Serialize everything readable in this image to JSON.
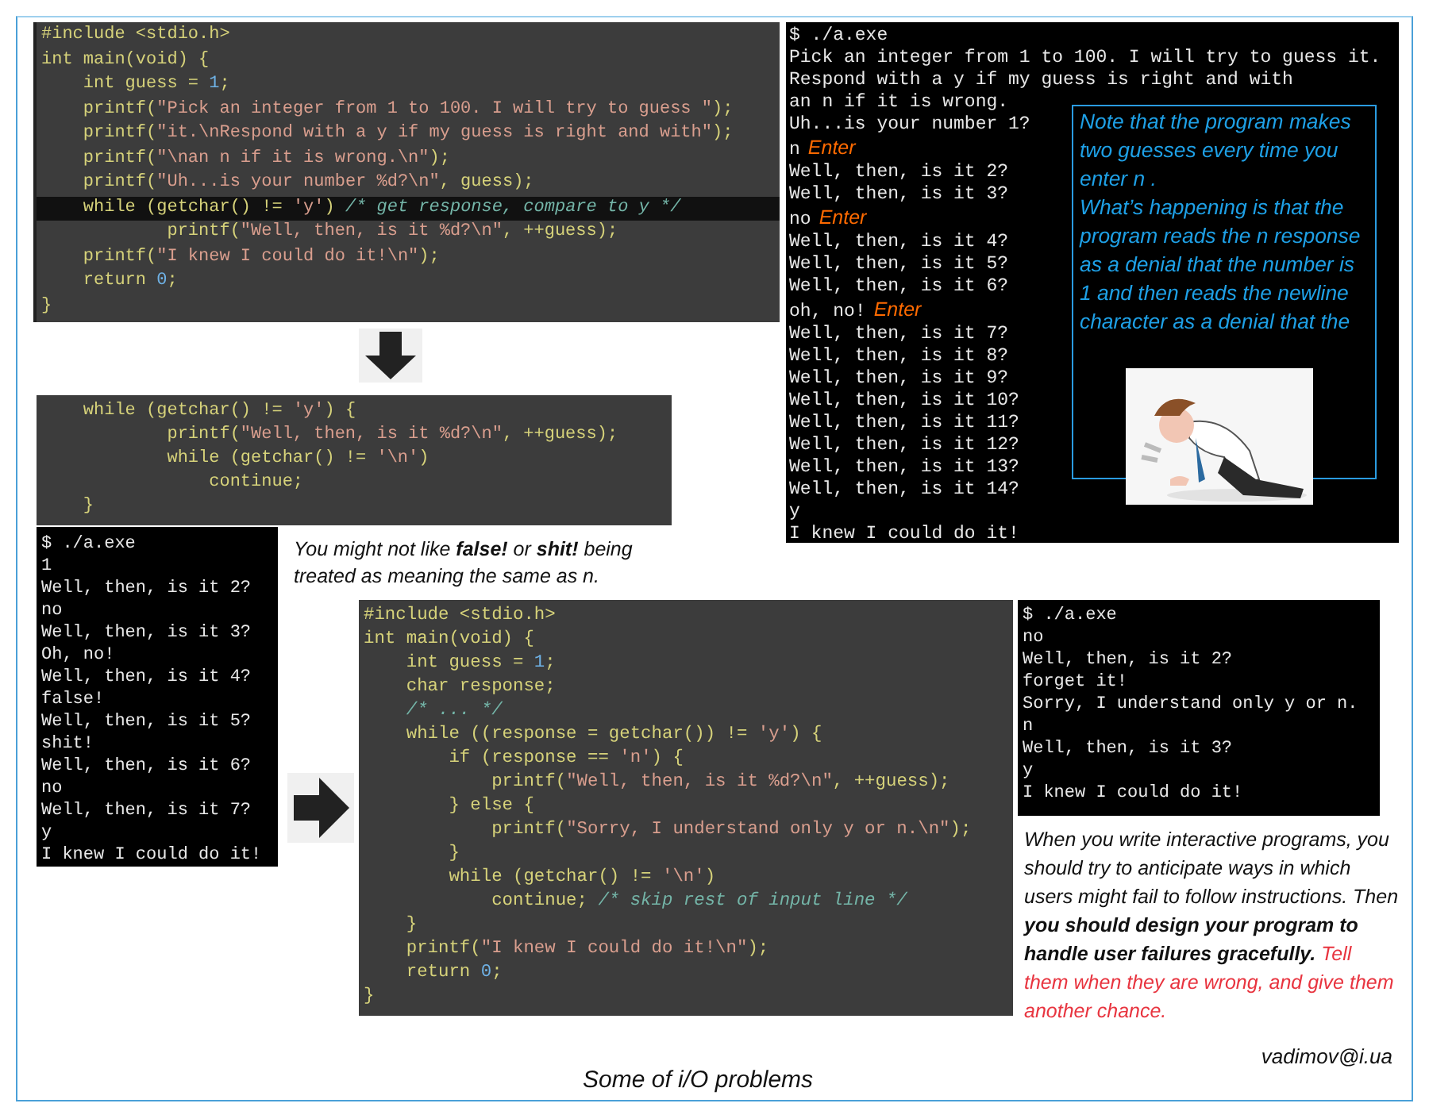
{
  "code_editors": [
    {
      "lines": [
        {
          "text": "#include <stdio.h>",
          "current": false
        },
        {
          "text": "int main(void) {",
          "current": false
        },
        {
          "text": "    int guess = 1;",
          "current": false
        },
        {
          "text": "    printf(\"Pick an integer from 1 to 100. I will try to guess \");",
          "current": false
        },
        {
          "text": "    printf(\"it.\\nRespond with a y if my guess is right and with\");",
          "current": false
        },
        {
          "text": "    printf(\"\\nan n if it is wrong.\\n\");",
          "current": false
        },
        {
          "text": "    printf(\"Uh...is your number %d?\\n\", guess);",
          "current": false
        },
        {
          "text": "    while (getchar() != 'y') /* get response, compare to y */",
          "current": true
        },
        {
          "text": "            printf(\"Well, then, is it %d?\\n\", ++guess);",
          "current": false
        },
        {
          "text": "    printf(\"I knew I could do it!\\n\");",
          "current": false
        },
        {
          "text": "    return 0;",
          "current": false
        },
        {
          "text": "}",
          "current": false
        }
      ]
    },
    {
      "lines": [
        {
          "text": "    while (getchar() != 'y') {",
          "current": false
        },
        {
          "text": "            printf(\"Well, then, is it %d?\\n\", ++guess);",
          "current": false
        },
        {
          "text": "            while (getchar() != '\\n')",
          "current": false
        },
        {
          "text": "                continue;",
          "current": false
        },
        {
          "text": "    }",
          "current": false
        }
      ]
    },
    {
      "lines": [
        {
          "text": "#include <stdio.h>",
          "current": false
        },
        {
          "text": "int main(void) {",
          "current": false
        },
        {
          "text": "    int guess = 1;",
          "current": false
        },
        {
          "text": "    char response;",
          "current": false
        },
        {
          "text": "    /* ... */",
          "current": false
        },
        {
          "text": "    while ((response = getchar()) != 'y') {",
          "current": false
        },
        {
          "text": "        if (response == 'n') {",
          "current": false
        },
        {
          "text": "            printf(\"Well, then, is it %d?\\n\", ++guess);",
          "current": false
        },
        {
          "text": "        } else {",
          "current": false
        },
        {
          "text": "            printf(\"Sorry, I understand only y or n.\\n\");",
          "current": false
        },
        {
          "text": "        }",
          "current": false
        },
        {
          "text": "        while (getchar() != '\\n')",
          "current": false
        },
        {
          "text": "            continue; /* skip rest of input line */",
          "current": false
        },
        {
          "text": "    }",
          "current": false
        },
        {
          "text": "    printf(\"I knew I could do it!\\n\");",
          "current": false
        },
        {
          "text": "    return 0;",
          "current": false
        },
        {
          "text": "}",
          "current": false
        }
      ]
    }
  ],
  "terminals": [
    {
      "lines": [
        {
          "text": "$ ./a.exe"
        },
        {
          "text": "Pick an integer from 1 to 100. I will try to guess it."
        },
        {
          "text": "Respond with a y if my guess is right and with"
        },
        {
          "text": "an n if it is wrong."
        },
        {
          "text": "Uh...is your number 1?"
        },
        {
          "text": "n",
          "note": "Enter"
        },
        {
          "text": "Well, then, is it 2?"
        },
        {
          "text": "Well, then, is it 3?"
        },
        {
          "text": "no",
          "note": "Enter"
        },
        {
          "text": "Well, then, is it 4?"
        },
        {
          "text": "Well, then, is it 5?"
        },
        {
          "text": "Well, then, is it 6?"
        },
        {
          "text": "oh, no!",
          "note": "Enter"
        },
        {
          "text": "Well, then, is it 7?"
        },
        {
          "text": "Well, then, is it 8?"
        },
        {
          "text": "Well, then, is it 9?"
        },
        {
          "text": "Well, then, is it 10?"
        },
        {
          "text": "Well, then, is it 11?"
        },
        {
          "text": "Well, then, is it 12?"
        },
        {
          "text": "Well, then, is it 13?"
        },
        {
          "text": "Well, then, is it 14?"
        },
        {
          "text": "y"
        },
        {
          "text": "I knew I could do it!"
        }
      ],
      "note_box": {
        "paragraphs": [
          "Note that the program makes two guesses every time you enter n .",
          "What’s happening is that the program reads the n response as a denial that the number is 1 and then reads the newline character as a denial that the"
        ],
        "picture": {
          "kind": "picture"
        }
      }
    },
    {
      "lines": [
        {
          "text": "$ ./a.exe"
        },
        {
          "text": "1"
        },
        {
          "text": "Well, then, is it 2?"
        },
        {
          "text": "no"
        },
        {
          "text": "Well, then, is it 3?"
        },
        {
          "text": "Oh, no!"
        },
        {
          "text": "Well, then, is it 4?"
        },
        {
          "text": "false!"
        },
        {
          "text": "Well, then, is it 5?"
        },
        {
          "text": "shit!"
        },
        {
          "text": "Well, then, is it 6?"
        },
        {
          "text": "no"
        },
        {
          "text": "Well, then, is it 7?"
        },
        {
          "text": "y"
        },
        {
          "text": "I knew I could do it!"
        }
      ]
    },
    {
      "lines": [
        {
          "text": "$ ./a.exe"
        },
        {
          "text": "no"
        },
        {
          "text": "Well, then, is it 2?"
        },
        {
          "text": "forget it!"
        },
        {
          "text": "Sorry, I understand only y or n."
        },
        {
          "text": "n"
        },
        {
          "text": "Well, then, is it 3?"
        },
        {
          "text": "y"
        },
        {
          "text": "I knew I could do it!"
        }
      ]
    }
  ],
  "caption": "You might not like **false!** or **shit!** being treated as meaning the same as n.",
  "advice": {
    "text": "When you write interactive programs, you should try to anticipate ways in which users might fail to follow instructions. Then **you should design your program to handle user failures gracefully.**",
    "highlight": "Tell them when they are wrong, and give them another chance."
  },
  "title": "Some of i/O problems",
  "author": "vadimov@i.ua"
}
